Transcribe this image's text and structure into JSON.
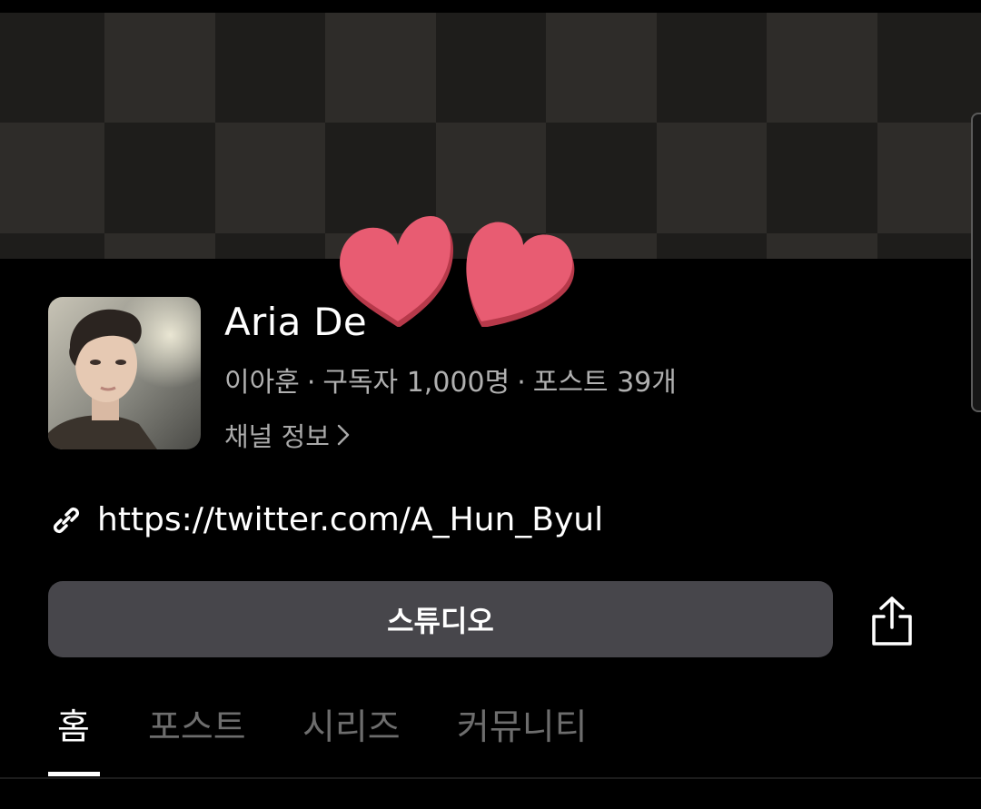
{
  "channel": {
    "name": "Aria De",
    "owner": "이아훈",
    "subscribers": "구독자 1,000명",
    "posts_count": "포스트 39개",
    "separator": "·",
    "info_link": "채널 정보",
    "url": "https://twitter.com/A_Hun_Byul"
  },
  "actions": {
    "studio_label": "스튜디오"
  },
  "tabs": [
    {
      "label": "홈",
      "active": true
    },
    {
      "label": "포스트",
      "active": false
    },
    {
      "label": "시리즈",
      "active": false
    },
    {
      "label": "커뮤니티",
      "active": false
    }
  ],
  "icons": {
    "link": "link-icon",
    "share": "share-icon",
    "chevron": "chevron-right-icon"
  },
  "colors": {
    "background": "#000000",
    "button": "#47464b",
    "heart": "#e85c72",
    "muted_text": "#b0b0b0",
    "inactive_tab": "#6d6d6d"
  }
}
